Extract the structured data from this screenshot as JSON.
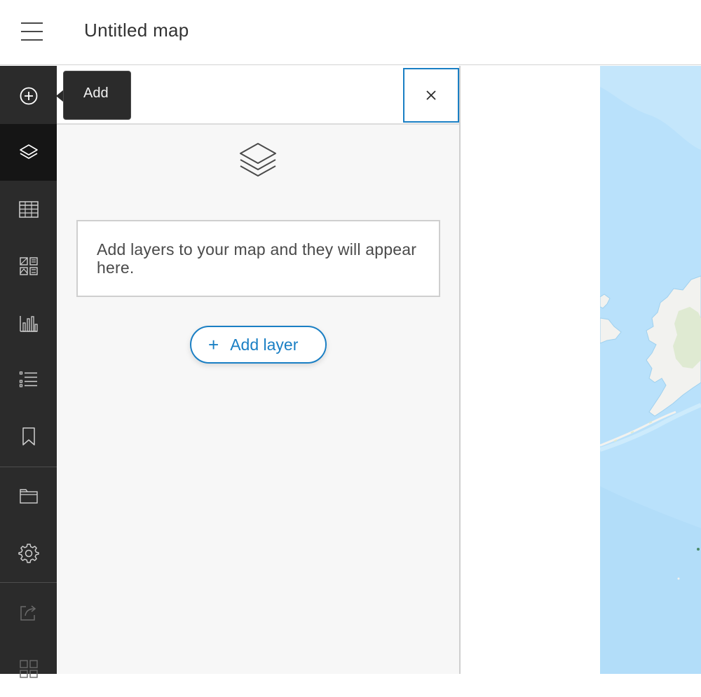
{
  "header": {
    "title": "Untitled map",
    "menu_icon": "hamburger-menu-icon"
  },
  "action_bar": {
    "items": [
      {
        "name": "add",
        "icon": "add-circle-icon",
        "active": false
      },
      {
        "name": "layers",
        "icon": "layers-icon",
        "active": true
      },
      {
        "name": "tables",
        "icon": "table-icon",
        "active": false
      },
      {
        "name": "legend",
        "icon": "legend-grid-icon",
        "active": false
      },
      {
        "name": "charts",
        "icon": "bar-chart-icon",
        "active": false
      },
      {
        "name": "sketch-list",
        "icon": "list-icon",
        "active": false
      },
      {
        "name": "bookmarks",
        "icon": "bookmark-icon",
        "active": false
      },
      {
        "name": "open",
        "icon": "folder-icon",
        "active": false
      },
      {
        "name": "settings",
        "icon": "gear-icon",
        "active": false
      },
      {
        "name": "share",
        "icon": "share-icon",
        "active": false
      },
      {
        "name": "apps",
        "icon": "apps-grid-icon",
        "active": false
      }
    ]
  },
  "tooltip": {
    "label": "Add"
  },
  "panel": {
    "close_icon": "close-icon",
    "empty_message": "Add layers to your map and they will appear here.",
    "add_layer": {
      "plus": "+",
      "label": "Add layer"
    }
  },
  "colors": {
    "accent": "#1a7fc4",
    "action_bar_bg": "#2b2b2b",
    "action_bar_active": "#151515",
    "panel_bg": "#f7f7f7",
    "water": "#b9e1fb",
    "land": "#f2f2ef"
  }
}
